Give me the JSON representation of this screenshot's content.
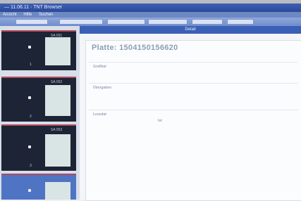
{
  "window": {
    "title": "— 11.06.11 · TNT Browser"
  },
  "menu": [
    "Ansicht",
    "Hilfe",
    "Suchen"
  ],
  "tabs": [
    "",
    "",
    "",
    "",
    "",
    ""
  ],
  "main": {
    "header_title": "Detail",
    "page_title": "Platte: 1504150156620",
    "sections": [
      {
        "title": "Grafikal",
        "rows": [
          {
            "label": "",
            "value": ""
          }
        ]
      },
      {
        "title": "Übergaben",
        "rows": [
          {
            "label": "",
            "value": ""
          },
          {
            "label": "",
            "value": ""
          },
          {
            "label": "",
            "value": ""
          }
        ]
      },
      {
        "title": "Lesedat",
        "columns": [
          "",
          "Ist",
          "",
          ""
        ],
        "rows": [
          [
            "",
            "",
            "",
            ""
          ],
          [
            "",
            "",
            "",
            ""
          ],
          [
            "",
            "",
            "",
            ""
          ],
          [
            "",
            "",
            "",
            ""
          ],
          [
            "",
            "",
            "",
            ""
          ]
        ]
      }
    ]
  },
  "thumbnails": [
    {
      "title": "SA 051",
      "number": "1"
    },
    {
      "title": "SA 052",
      "number": "2"
    },
    {
      "title": "SA 053",
      "number": "3"
    },
    {
      "title": "",
      "number": ""
    }
  ]
}
